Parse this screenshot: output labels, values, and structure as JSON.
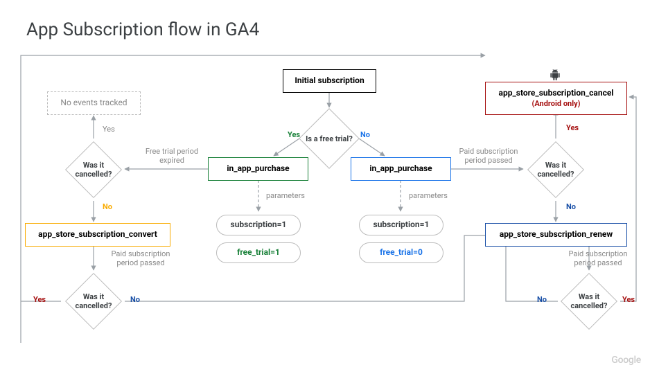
{
  "title": "App Subscription flow in GA4",
  "nodes": {
    "initial": "Initial subscription",
    "free_trial_q": "Is a free trial?",
    "iap_green": "in_app_purchase",
    "iap_blue": "in_app_purchase",
    "sub1_a": "subscription=1",
    "sub1_b": "subscription=1",
    "free1": "free_trial=1",
    "free0": "free_trial=0",
    "cancelled_left": "Was it cancelled?",
    "cancelled_left2": "Was it cancelled?",
    "cancelled_right": "Was it cancelled?",
    "cancelled_right2": "Was it cancelled?",
    "no_events": "No events tracked",
    "convert": "app_store_subscription_convert",
    "renew": "app_store_subscription_renew",
    "cancel_main": "app_store_subscription_cancel",
    "cancel_sub": "(Android only)"
  },
  "labels": {
    "yes": "Yes",
    "no": "No",
    "params": "parameters",
    "free_trial_expired": "Free trial period expired",
    "paid_passed": "Paid subscription period passed"
  },
  "footer": "Google",
  "icons": {
    "android": "🤖"
  }
}
